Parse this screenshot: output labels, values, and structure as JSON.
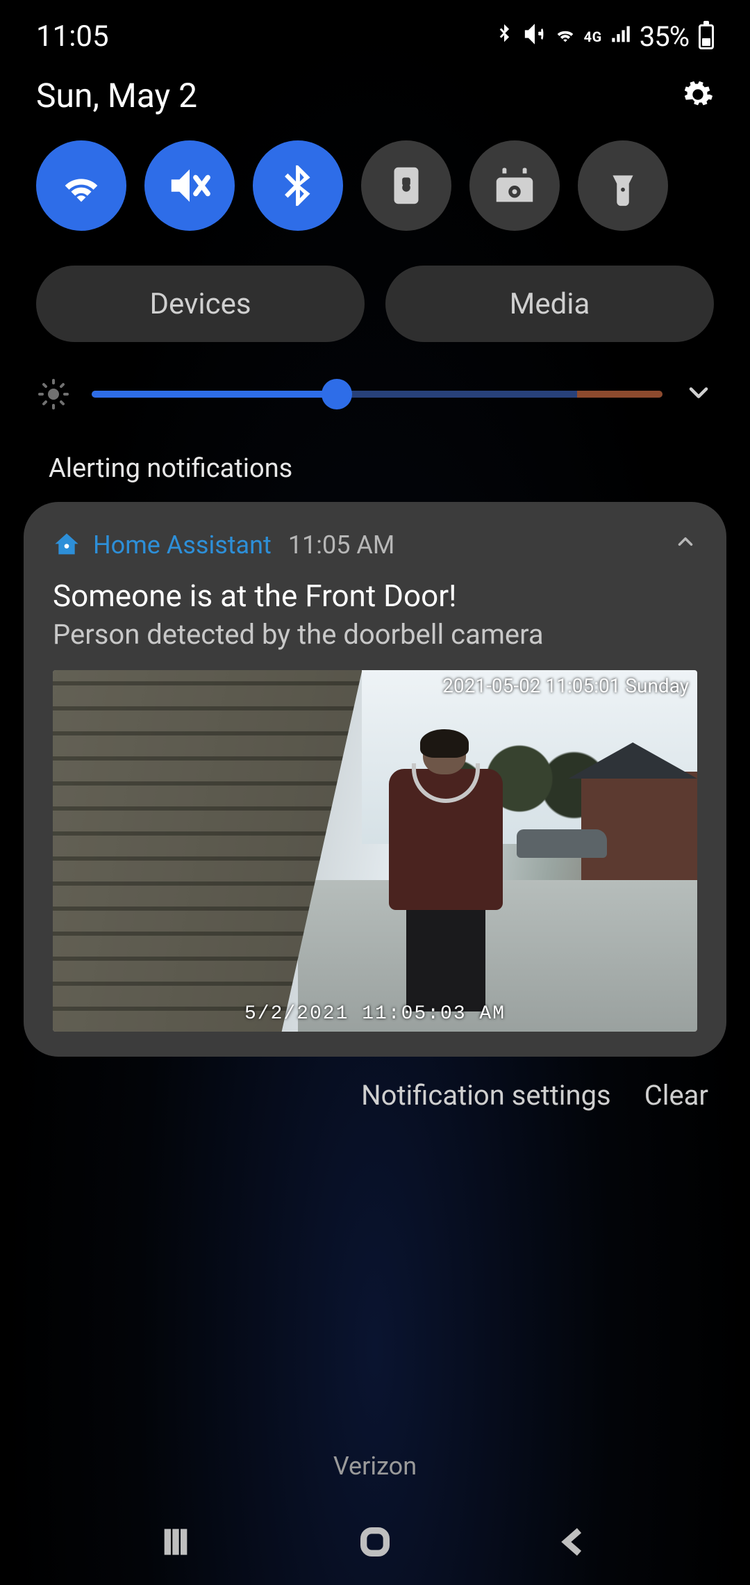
{
  "status": {
    "time": "11:05",
    "battery_pct": "35%",
    "network_label": "4G"
  },
  "header": {
    "date": "Sun, May 2"
  },
  "quick_settings": {
    "items": [
      {
        "name": "wifi",
        "active": true
      },
      {
        "name": "mute-vibrate",
        "active": true
      },
      {
        "name": "bluetooth",
        "active": true
      },
      {
        "name": "rotation-lock",
        "active": false
      },
      {
        "name": "smart-home",
        "active": false
      },
      {
        "name": "flashlight",
        "active": false
      }
    ]
  },
  "panels": {
    "devices": "Devices",
    "media": "Media"
  },
  "brightness": {
    "value_pct": 43,
    "warm_zone_start_pct": 85
  },
  "section_title": "Alerting notifications",
  "notification": {
    "app_name": "Home Assistant",
    "time": "11:05 AM",
    "title": "Someone is at the Front Door!",
    "body": "Person detected by the doorbell camera",
    "camera_overlay_top": "2021-05-02 11:05:01 Sunday",
    "camera_overlay_bottom": "5/2/2021 11:05:03 AM"
  },
  "actions": {
    "settings": "Notification settings",
    "clear": "Clear"
  },
  "carrier": "Verizon"
}
